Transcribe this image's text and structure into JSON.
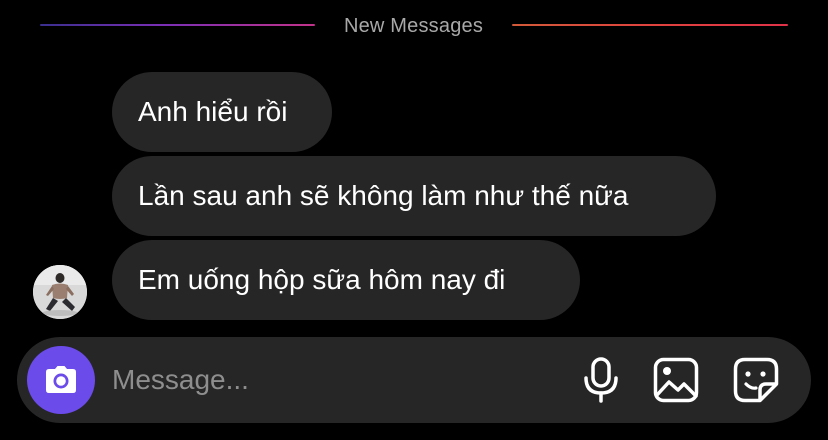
{
  "divider": {
    "label": "New Messages"
  },
  "messages": [
    {
      "text": "Anh hiểu rồi"
    },
    {
      "text": "Lần sau anh sẽ không làm như thế nữa"
    },
    {
      "text": "Em uống hộp sữa hôm nay đi"
    }
  ],
  "composer": {
    "placeholder": "Message...",
    "value": ""
  },
  "icons": {
    "camera": "camera-icon",
    "mic": "microphone-icon",
    "gallery": "image-gallery-icon",
    "sticker": "sticker-icon"
  },
  "colors": {
    "background": "#000000",
    "bubble": "#262626",
    "accent": "#6b4bea",
    "divider_text": "#a8a8a8",
    "placeholder": "#8e8e8e"
  }
}
